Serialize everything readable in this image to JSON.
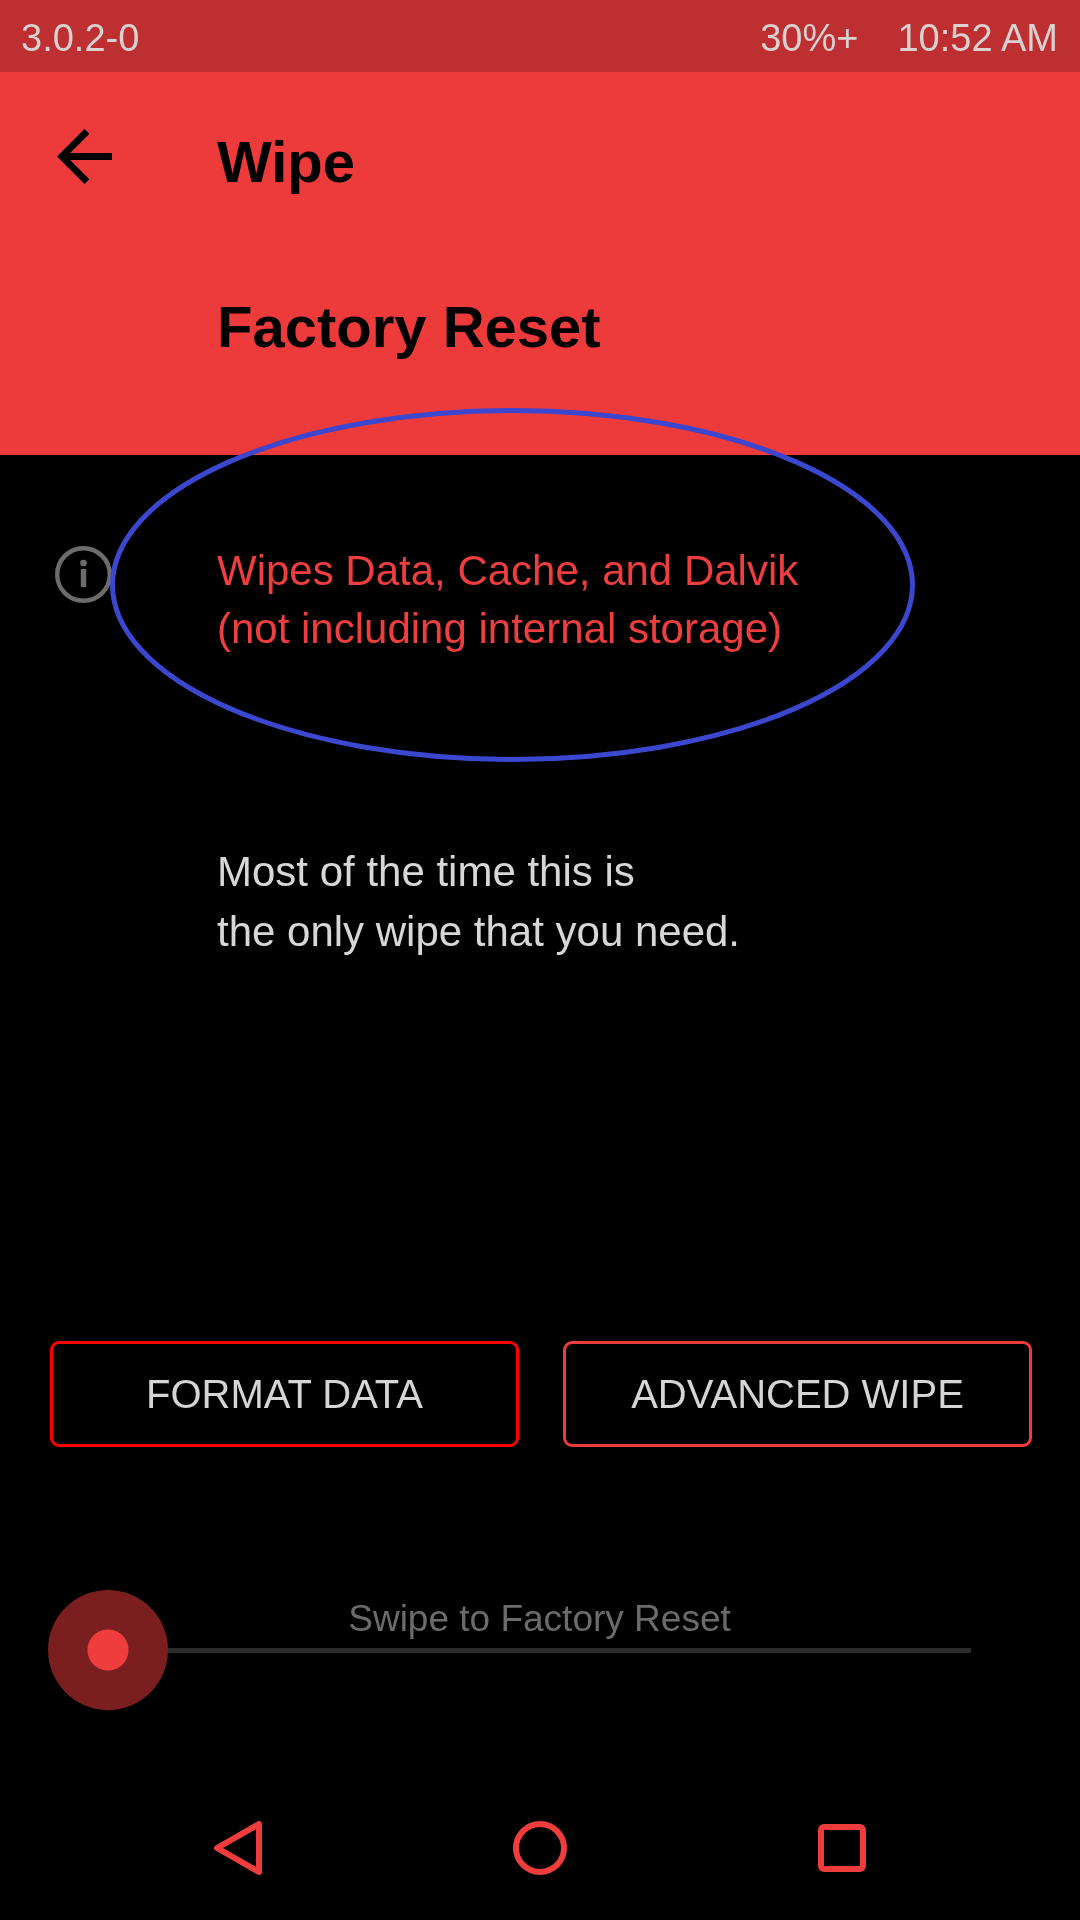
{
  "status_bar": {
    "version": "3.0.2-0",
    "battery": "30%+",
    "time": "10:52 AM"
  },
  "header": {
    "title": "Wipe",
    "subtitle": "Factory Reset"
  },
  "info": {
    "text": "Wipes Data, Cache, and Dalvik\n(not including internal storage)"
  },
  "note": {
    "text": "Most of the time this is\nthe only wipe that you need."
  },
  "buttons": [
    {
      "label": "FORMAT DATA",
      "color": "#ff0000"
    },
    {
      "label": "ADVANCED WIPE",
      "color": "#ee3c3c"
    }
  ],
  "slider": {
    "label": "Swipe to Factory Reset",
    "level": 0
  },
  "nav_bar": [
    {
      "kind": "back"
    },
    {
      "kind": "home"
    },
    {
      "kind": "recents"
    }
  ],
  "annotation": {
    "kind": "ellipse"
  }
}
